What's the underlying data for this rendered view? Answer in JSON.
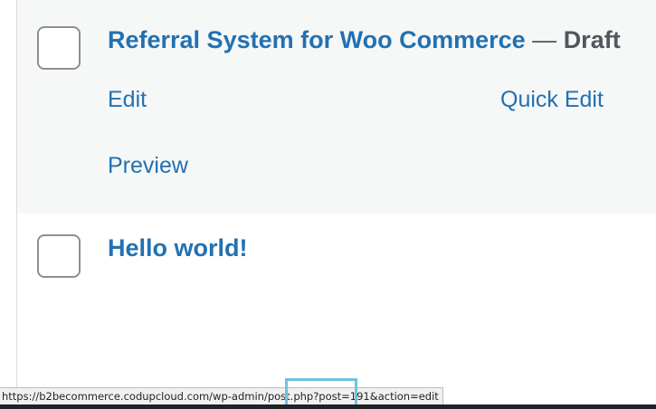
{
  "posts": [
    {
      "title": "Referral System for Woo Commerce",
      "separator": "—",
      "state": "Draft",
      "actions": {
        "edit": "Edit",
        "quick_edit": "Quick Edit",
        "preview": "Preview"
      },
      "highlighted": true
    },
    {
      "title": "Hello world!"
    }
  ],
  "statusbar": {
    "url": "https://b2becommerce.codupcloud.com/wp-admin/post.php?post=191&action=edit"
  },
  "colors": {
    "link": "#2271b1",
    "state": "#50575e",
    "highlight_row": "#f6f7f7",
    "callout": "#6fc4dc"
  }
}
